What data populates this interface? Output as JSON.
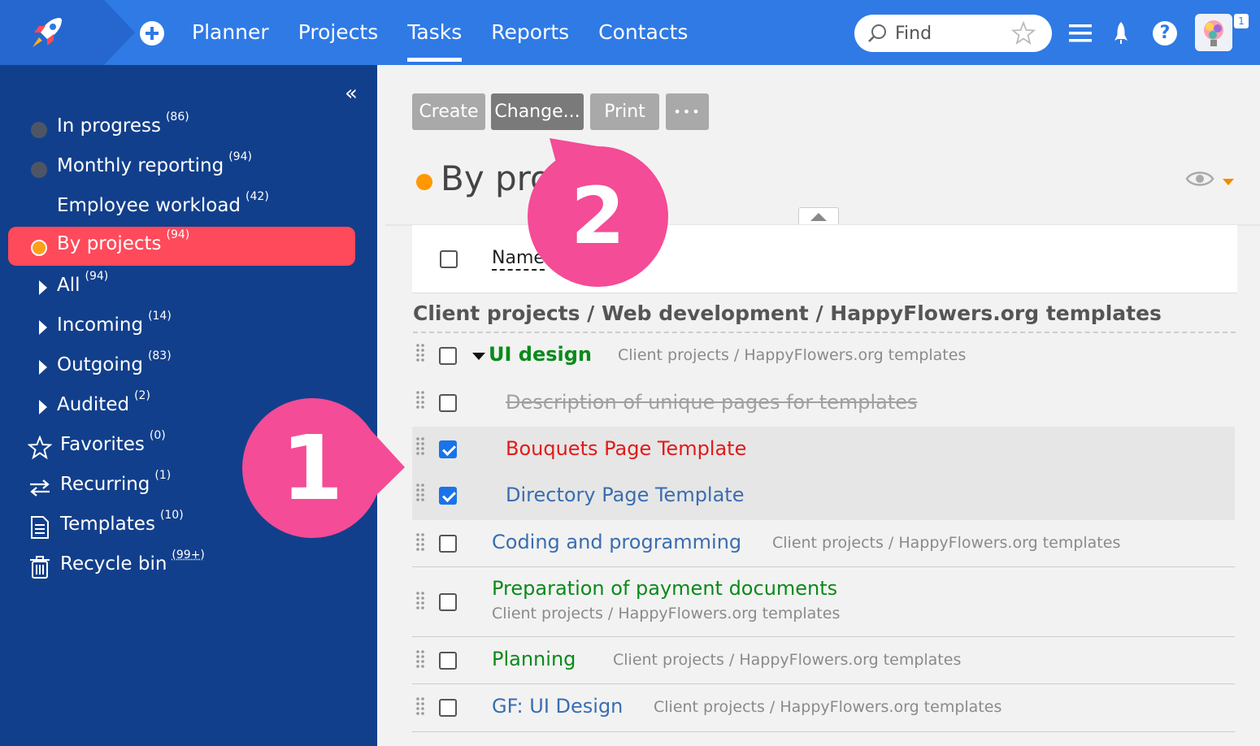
{
  "nav": {
    "items": [
      {
        "label": "Planner",
        "active": false
      },
      {
        "label": "Projects",
        "active": false
      },
      {
        "label": "Tasks",
        "active": true
      },
      {
        "label": "Reports",
        "active": false
      },
      {
        "label": "Contacts",
        "active": false
      }
    ],
    "search_placeholder": "Find",
    "help_label": "?",
    "notification_count": "1"
  },
  "sidebar": {
    "collapse_label": "«",
    "items": [
      {
        "label": "In progress",
        "count": "(86)"
      },
      {
        "label": "Monthly reporting",
        "count": "(94)"
      },
      {
        "label": "Employee workload",
        "count": "(42)"
      },
      {
        "label": "By projects",
        "count": "(94)",
        "active": true
      },
      {
        "label": "All",
        "count": "(94)"
      },
      {
        "label": "Incoming",
        "count": "(14)"
      },
      {
        "label": "Outgoing",
        "count": "(83)"
      },
      {
        "label": "Audited",
        "count": "(2)"
      },
      {
        "label": "Favorites",
        "count": "(0)"
      },
      {
        "label": "Recurring",
        "count": "(1)"
      },
      {
        "label": "Templates",
        "count": "(10)"
      },
      {
        "label": "Recycle bin",
        "count": "(99+)"
      }
    ]
  },
  "toolbar": {
    "create_label": "Create",
    "change_label": "Change...",
    "print_label": "Print",
    "more_label": "•••"
  },
  "page": {
    "title": "By proj",
    "name_column": "Name"
  },
  "group": {
    "title": "Client projects / Web development / HappyFlowers.org templates"
  },
  "tasks": [
    {
      "name": "UI design",
      "path": "Client projects / HappyFlowers.org templates",
      "checked": false
    },
    {
      "name": "Description of unique pages for templates",
      "checked": false,
      "completed": true
    },
    {
      "name": "Bouquets Page Template",
      "checked": true
    },
    {
      "name": "Directory Page Template",
      "checked": true
    },
    {
      "name": "Coding and programming",
      "path": "Client projects / HappyFlowers.org templates",
      "checked": false
    },
    {
      "name": "Preparation of payment documents",
      "path": "Client projects / HappyFlowers.org templates",
      "checked": false
    },
    {
      "name": "Planning",
      "path": "Client projects / HappyFlowers.org templates",
      "checked": false
    },
    {
      "name": "GF: UI Design",
      "path": "Client projects / HappyFlowers.org templates",
      "checked": false
    }
  ],
  "callouts": {
    "one": "1",
    "two": "2"
  },
  "colors": {
    "topbar": "#2f7ae5",
    "sidebar": "#123f8b",
    "active_item": "#ff4a5b",
    "callout": "#f44c96",
    "green_task": "#0a8a1a",
    "blue_task": "#3a6db0",
    "red_task": "#e11a1a"
  }
}
